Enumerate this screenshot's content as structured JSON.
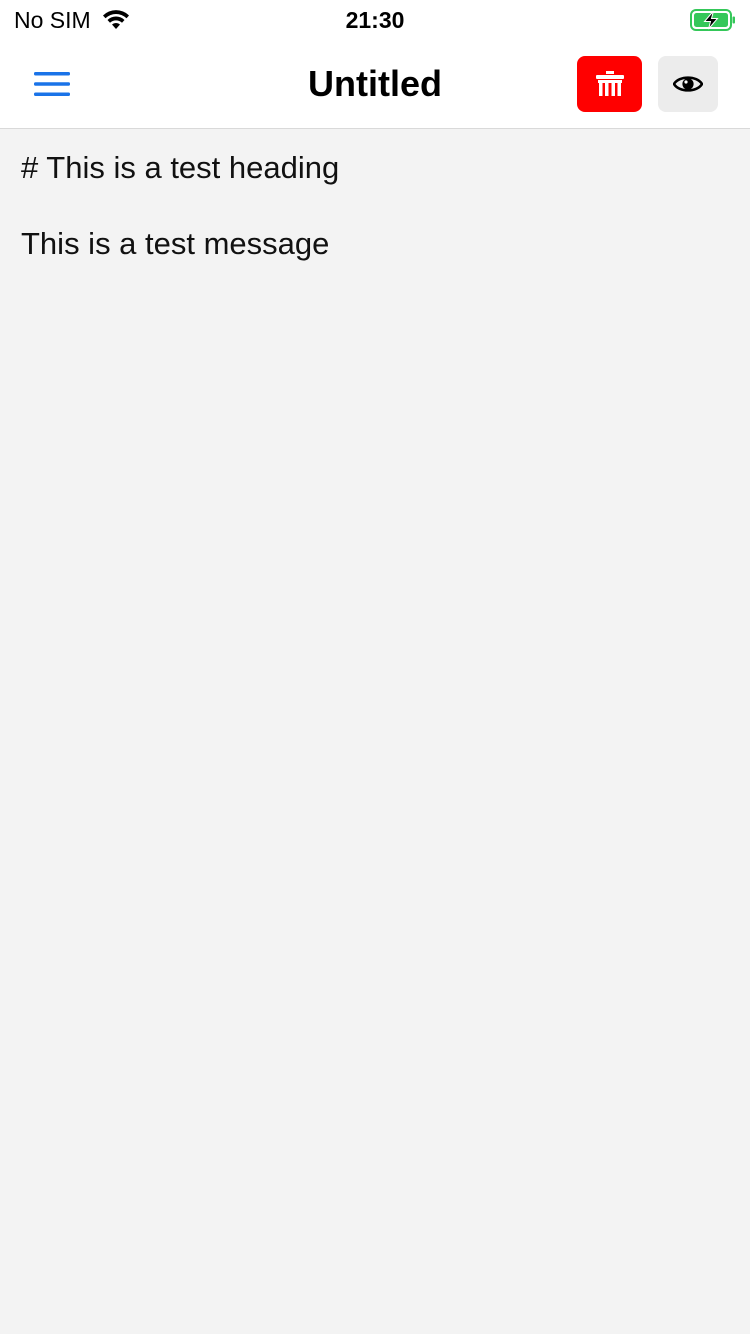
{
  "status_bar": {
    "carrier": "No SIM",
    "time": "21:30",
    "battery_state": "charging",
    "battery_color": "#34c759"
  },
  "nav_bar": {
    "title": "Untitled",
    "menu_icon": "hamburger-menu-icon",
    "menu_icon_color": "#1a73e8",
    "delete_icon": "trash-icon",
    "delete_button_color": "#ff0000",
    "preview_icon": "eye-icon"
  },
  "editor": {
    "lines": [
      "# This is a test heading",
      "This is a test message"
    ]
  }
}
